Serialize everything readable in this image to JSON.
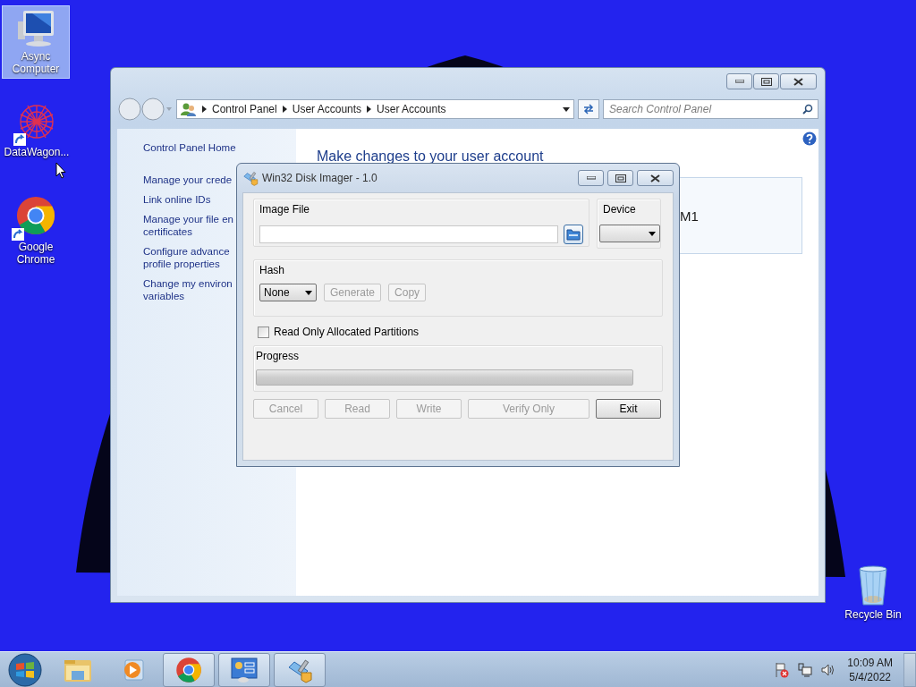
{
  "desktop_icons": [
    {
      "label": "Async Computer",
      "selected": true,
      "kind": "computer"
    },
    {
      "label": "DataWagon...",
      "selected": false,
      "kind": "app"
    },
    {
      "label": "Google Chrome",
      "selected": false,
      "kind": "chrome"
    },
    {
      "label": "Recycle Bin",
      "selected": false,
      "kind": "bin"
    }
  ],
  "control_panel": {
    "breadcrumb": [
      "Control Panel",
      "User Accounts",
      "User Accounts"
    ],
    "search": {
      "placeholder": "Search Control Panel"
    },
    "sidebar": {
      "items": [
        {
          "lines": [
            "Control Panel Home"
          ]
        },
        {
          "lines": [
            "Manage your crede"
          ]
        },
        {
          "lines": [
            "Link online IDs"
          ]
        },
        {
          "lines": [
            "Manage your file en",
            "certificates"
          ]
        },
        {
          "lines": [
            "Configure advance",
            "profile properties"
          ]
        },
        {
          "lines": [
            "Change my environ",
            "variables"
          ]
        }
      ]
    },
    "heading": "Make changes to your user account",
    "account_text": "M1"
  },
  "dialog": {
    "title": "Win32 Disk Imager - 1.0",
    "image_file": {
      "label": "Image File"
    },
    "device": {
      "label": "Device"
    },
    "hash": {
      "label": "Hash",
      "value": "None",
      "buttons": [
        {
          "label": "Generate",
          "disabled": true
        },
        {
          "label": "Copy",
          "disabled": true
        }
      ]
    },
    "checkbox": {
      "label": "Read Only Allocated Partitions",
      "checked": false
    },
    "progress": {
      "label": "Progress",
      "level": 0
    },
    "buttons": [
      {
        "label": "Cancel",
        "disabled": true
      },
      {
        "label": "Read",
        "disabled": true
      },
      {
        "label": "Write",
        "disabled": true
      },
      {
        "label": "Verify Only",
        "disabled": true
      },
      {
        "label": "Exit",
        "disabled": false
      }
    ]
  },
  "taskbar": {
    "items": [
      {
        "kind": "explorer",
        "running": false
      },
      {
        "kind": "media",
        "running": false
      },
      {
        "kind": "chrome",
        "running": true
      },
      {
        "kind": "control-panel",
        "running": true
      },
      {
        "kind": "disk-imager",
        "running": true
      }
    ],
    "clock": {
      "time": "10:09 AM",
      "date": "5/4/2022"
    }
  }
}
